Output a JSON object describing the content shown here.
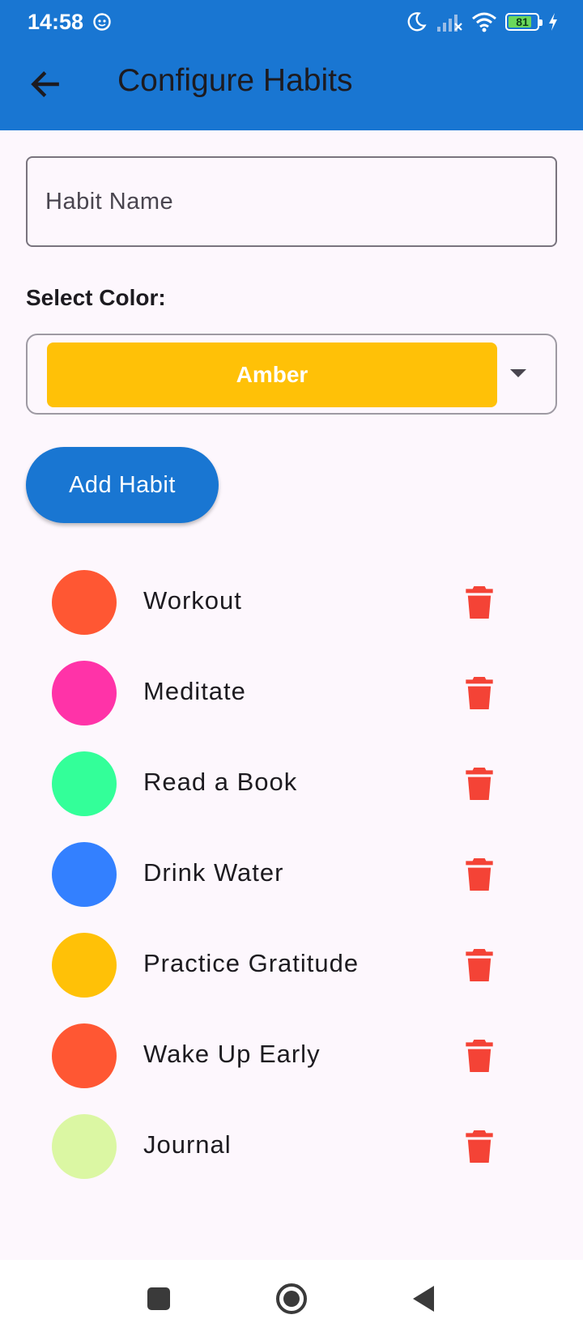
{
  "status_bar": {
    "time": "14:58",
    "battery_level": "81",
    "battery_fraction": 0.81,
    "icons": [
      "app-notification-icon",
      "moon-icon",
      "signal-icon",
      "wifi-icon",
      "battery-icon",
      "charging-icon"
    ]
  },
  "app_bar": {
    "title": "Configure Habits",
    "back_icon": "arrow-left-icon",
    "background": "#1976d2"
  },
  "form": {
    "habit_name_placeholder": "Habit Name",
    "habit_name_value": "",
    "select_color_label": "Select Color:",
    "selected_color": {
      "label": "Amber",
      "hex": "#ffc107"
    },
    "add_button_label": "Add Habit",
    "add_button_color": "#1976d2"
  },
  "habits": [
    {
      "name": "Workout",
      "color": "#ff5733"
    },
    {
      "name": "Meditate",
      "color": "#ff33a8"
    },
    {
      "name": "Read a Book",
      "color": "#33ff99"
    },
    {
      "name": "Drink Water",
      "color": "#3380ff"
    },
    {
      "name": "Practice Gratitude",
      "color": "#ffc107"
    },
    {
      "name": "Wake Up Early",
      "color": "#ff5733"
    },
    {
      "name": "Journal",
      "color": "#dbf7a3"
    }
  ],
  "delete_icon_color": "#f44336",
  "nav_bar": {
    "icons": [
      "square-icon",
      "home-circle-icon",
      "back-triangle-icon"
    ]
  }
}
